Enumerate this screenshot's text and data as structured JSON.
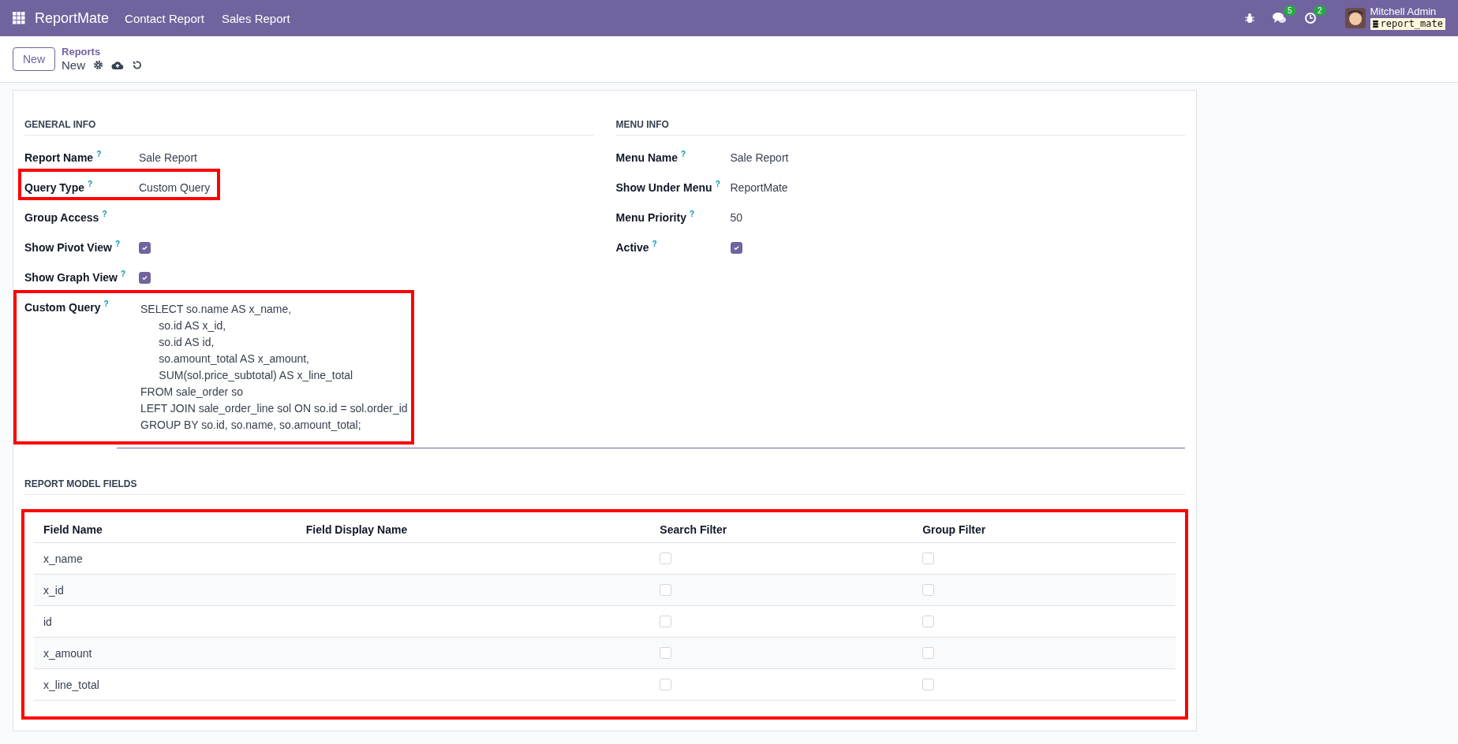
{
  "navbar": {
    "app_name": "ReportMate",
    "menus": [
      "Contact Report",
      "Sales Report"
    ],
    "messages_badge": "5",
    "activities_badge": "2",
    "user_name": "Mitchell Admin",
    "database": "report_mate"
  },
  "control_panel": {
    "new_button": "New",
    "breadcrumb": "Reports",
    "record_title": "New"
  },
  "general_info": {
    "title": "GENERAL INFO",
    "fields": [
      {
        "kind": "text",
        "label": "Report Name",
        "help": "?",
        "value": "Sale Report",
        "highlighted": false
      },
      {
        "kind": "text",
        "label": "Query Type",
        "help": "?",
        "value": "Custom Query",
        "highlighted": true
      },
      {
        "kind": "text",
        "label": "Group Access",
        "help": "?",
        "highlighted": false
      },
      {
        "kind": "checkbox",
        "label": "Show Pivot View",
        "help": "?",
        "checked": true,
        "highlighted": false
      },
      {
        "kind": "checkbox",
        "label": "Show Graph View",
        "help": "?",
        "checked": true,
        "highlighted": false
      },
      {
        "kind": "code",
        "label": "Custom Query",
        "help": "?",
        "value": "SELECT so.name AS x_name,\n      so.id AS x_id,\n      so.id AS id,\n      so.amount_total AS x_amount,\n      SUM(sol.price_subtotal) AS x_line_total\nFROM sale_order so\nLEFT JOIN sale_order_line sol ON so.id = sol.order_id\nGROUP BY so.id, so.name, so.amount_total;",
        "highlighted": true
      }
    ]
  },
  "menu_info": {
    "title": "MENU INFO",
    "fields": [
      {
        "kind": "text",
        "label": "Menu Name",
        "help": "?",
        "value": "Sale Report"
      },
      {
        "kind": "text",
        "label": "Show Under Menu",
        "help": "?",
        "value": "ReportMate"
      },
      {
        "kind": "text",
        "label": "Menu Priority",
        "help": "?",
        "value": "50"
      },
      {
        "kind": "checkbox",
        "label": "Active",
        "help": "?",
        "checked": true
      }
    ]
  },
  "report_model_fields": {
    "title": "REPORT MODEL FIELDS",
    "highlighted": true,
    "columns": [
      "Field Name",
      "Field Display Name",
      "Search Filter",
      "Group Filter"
    ],
    "rows": [
      {
        "field_name": "x_name",
        "search_filter": false,
        "group_filter": false
      },
      {
        "field_name": "x_id",
        "search_filter": false,
        "group_filter": false
      },
      {
        "field_name": "id",
        "search_filter": false,
        "group_filter": false
      },
      {
        "field_name": "x_amount",
        "search_filter": false,
        "group_filter": false
      },
      {
        "field_name": "x_line_total",
        "search_filter": false,
        "group_filter": false
      }
    ]
  }
}
